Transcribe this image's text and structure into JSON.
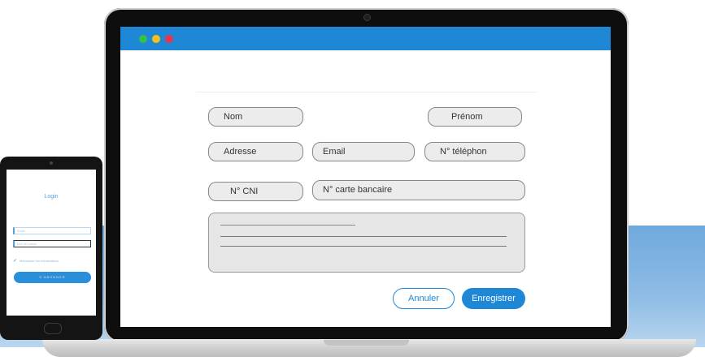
{
  "laptop": {
    "window_controls": [
      "close",
      "minimize",
      "maximize"
    ],
    "form": {
      "fields": {
        "nom": "Nom",
        "prenom": "Prénom",
        "adresse": "Adresse",
        "email": "Email",
        "telephone": "N° téléphon",
        "cni": "N° CNI",
        "carte_bancaire": "N° carte bancaire"
      },
      "buttons": {
        "cancel": "Annuler",
        "save": "Enregistrer"
      }
    }
  },
  "phone": {
    "title": "Login",
    "inputs": {
      "email_placeholder": "Email",
      "password_placeholder": "Mot de passe"
    },
    "remember_label": "Mémoriser les informations",
    "submit_label": "S'ABONNER"
  },
  "colors": {
    "accent": "#1e88d6",
    "dot_green": "#34c34a",
    "dot_yellow": "#f4c21b",
    "dot_red": "#e8334a"
  }
}
